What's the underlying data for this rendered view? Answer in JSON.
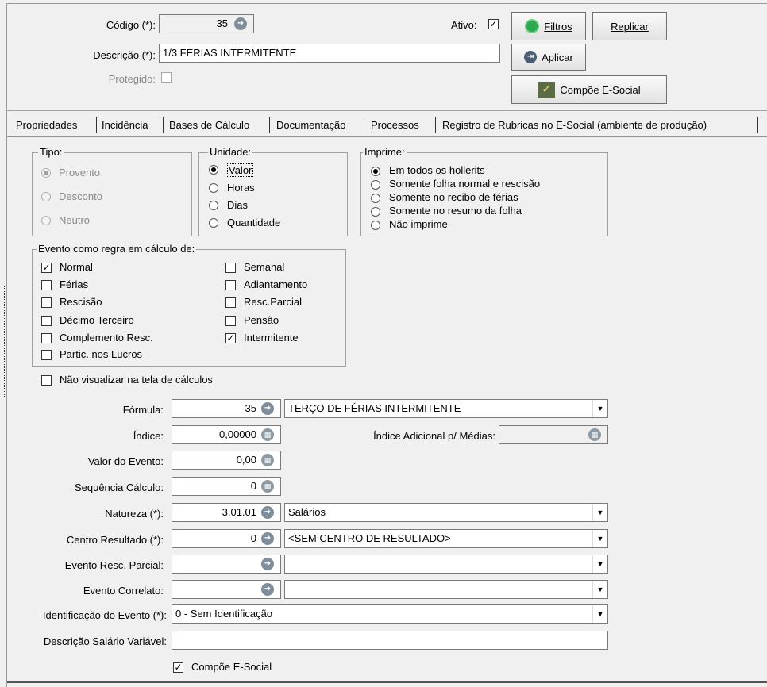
{
  "header": {
    "codigo_label": "Código (*):",
    "codigo_value": "35",
    "descricao_label": "Descrição (*):",
    "descricao_value": "1/3 FERIAS INTERMITENTE",
    "protegido_label": "Protegido:",
    "ativo_label": "Ativo:"
  },
  "buttons": {
    "filtros": "Filtros",
    "replicar": "Replicar",
    "aplicar": "Aplicar",
    "compoe_esocial": "Compõe E-Social"
  },
  "tabs": [
    {
      "label": "Propriedades"
    },
    {
      "label": "Incidência"
    },
    {
      "label": "Bases de Cálculo"
    },
    {
      "label": "Documentação"
    },
    {
      "label": "Processos"
    },
    {
      "label": "Registro de Rubricas no E-Social (ambiente de produção)"
    }
  ],
  "tipo": {
    "title": "Tipo:",
    "options": [
      "Provento",
      "Desconto",
      "Neutro"
    ]
  },
  "unidade": {
    "title": "Unidade:",
    "options": [
      "Valor",
      "Horas",
      "Dias",
      "Quantidade"
    ]
  },
  "imprime": {
    "title": "Imprime:",
    "options": [
      "Em todos os hollerits",
      "Somente folha normal e rescisão",
      "Somente no recibo de férias",
      "Somente no resumo da folha",
      "Não imprime"
    ]
  },
  "evento": {
    "title": "Evento como regra em cálculo de:",
    "left": [
      "Normal",
      "Férias",
      "Rescisão",
      "Décimo Terceiro",
      "Complemento Resc.",
      "Partic. nos Lucros"
    ],
    "right": [
      "Semanal",
      "Adiantamento",
      "Resc.Parcial",
      "Pensão",
      "Intermitente"
    ]
  },
  "nao_visualizar_label": "Não visualizar na tela de cálculos",
  "form": {
    "formula_label": "Fórmula:",
    "formula_code": "35",
    "formula_desc": "TERÇO DE FÉRIAS INTERMITENTE",
    "indice_label": "Índice:",
    "indice_value": "0,00000",
    "indice_adicional_label": "Índice Adicional p/ Médias:",
    "valor_evento_label": "Valor do Evento:",
    "valor_evento_value": "0,00",
    "sequencia_label": "Sequência Cálculo:",
    "sequencia_value": "0",
    "natureza_label": "Natureza (*):",
    "natureza_code": "3.01.01",
    "natureza_desc": "Salários",
    "centro_label": "Centro Resultado (*):",
    "centro_code": "0",
    "centro_desc": "<SEM CENTRO DE RESULTADO>",
    "resc_parcial_label": "Evento Resc. Parcial:",
    "correlato_label": "Evento Correlato:",
    "identificacao_label": "Identificação do Evento (*):",
    "identificacao_value": "0 - Sem Identificação",
    "desc_salario_label": "Descrição Salário Variável:",
    "compoe_label": "Compõe E-Social"
  }
}
